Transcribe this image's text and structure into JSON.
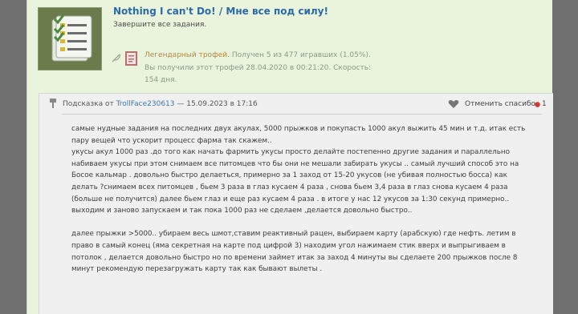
{
  "trophy": {
    "title": "Nothing I can't Do! / Мне все под силу!",
    "description": "Завершите все задания.",
    "rarity": "Легендарный трофей",
    "stats": ". Получен 5 из 477 игравших (1.05%).",
    "earned": "Вы получили этот трофей 28.04.2020 в 00:21:20. Скорость: 154 дня.",
    "icons": [
      "feather-icon",
      "book-icon"
    ]
  },
  "post": {
    "prefix": "Подсказка от ",
    "author": "TrollFace230613",
    "date": " — 15.09.2023 в 17:16",
    "thanks_label": "Отменить спасибо",
    "likes": "1",
    "paragraphs": [
      "самые нудные задания на последних двух акулах, 5000 прыжков и покупасть 1000 акул выжить 45 мин и т.д. итак есть пару вещей что ускорит процесс фарма так скажем..\nукусы акул 1000 раз .до того как начать фармить укусы просто делайте постепенно другие задания и параллельно набиваем укусы при этом снимаем все питомцев что бы они не мешали забирать укусы .. самый лучший способ это на Босое кальмар . довольно быстро делаеться, примерно за 1 заход от 15-20 укусов (не убивая полностью босса) как делать ?снимаем всех питомцев , бьем 3 раза в глаз кусаем 4 раза , снова бьем 3,4 раза в глаз снова кусаем 4 раза (больше не получится) далее бьем глаз и еще раз кусаем 4 раза . в итоге у нас 12 укусов за 1:30 секунд примерно.. выходим и заново запускаем и так пока 1000 раз не сделаем ,делается довольно быстро..",
      "далее прыжки >5000.. убираем весь шмот,ставим реактивный рацен, выбираем карту (арабскую) где нефть. летим в право в самый конец (яма секретная на карте под цифрой 3) находим угол нажимаем стик вверх и выпрыгиваем в потолок , делается довольно быстро но по времени займет итак за заход 4 минуты вы сделаете 200 прыжков после 8 минут рекомендую перезагружать карту так как бывают вылеты ."
    ]
  },
  "colors": {
    "panel_bg": "#eaf4dc",
    "title_link": "#2b6aa8",
    "rarity": "#b5873a",
    "post_bg": "#f0f0f0",
    "like": "#d23a3a"
  }
}
